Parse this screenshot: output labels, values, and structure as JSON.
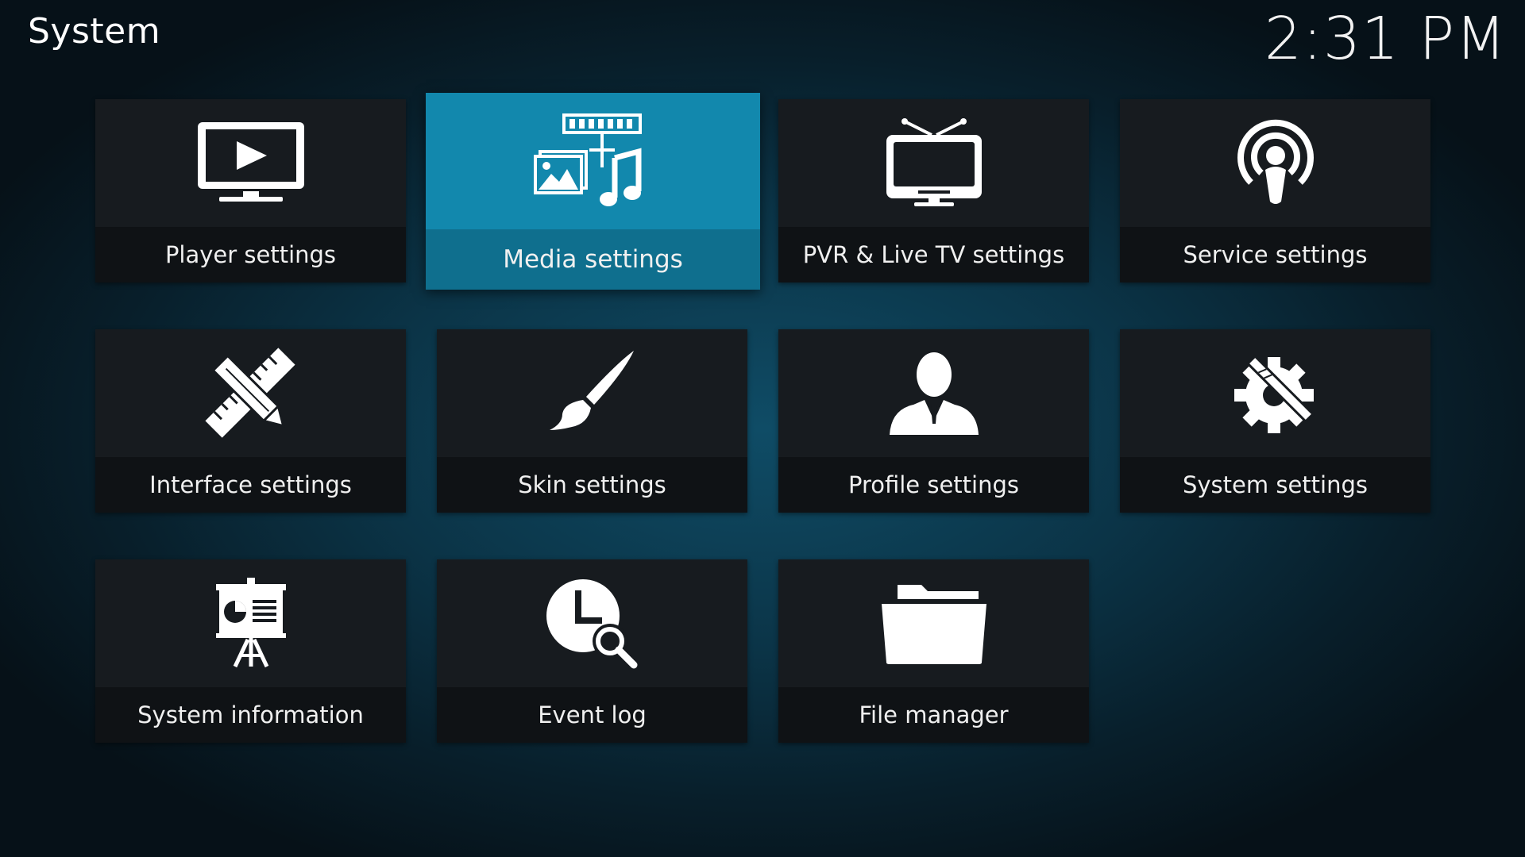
{
  "header": {
    "title": "System",
    "clock": "2:31 PM"
  },
  "tiles": [
    {
      "label": "Player settings",
      "icon": "tv-play-icon",
      "focused": false
    },
    {
      "label": "Media settings",
      "icon": "media-icon",
      "focused": true
    },
    {
      "label": "PVR & Live TV settings",
      "icon": "tv-antenna-icon",
      "focused": false
    },
    {
      "label": "Service settings",
      "icon": "broadcast-icon",
      "focused": false
    },
    {
      "label": "Interface settings",
      "icon": "pencil-ruler-icon",
      "focused": false
    },
    {
      "label": "Skin settings",
      "icon": "paintbrush-icon",
      "focused": false
    },
    {
      "label": "Profile settings",
      "icon": "user-icon",
      "focused": false
    },
    {
      "label": "System settings",
      "icon": "gear-tools-icon",
      "focused": false
    },
    {
      "label": "System information",
      "icon": "presentation-icon",
      "focused": false
    },
    {
      "label": "Event log",
      "icon": "clock-search-icon",
      "focused": false
    },
    {
      "label": "File manager",
      "icon": "folder-icon",
      "focused": false
    }
  ],
  "colors": {
    "accent": "#1289ae",
    "tile_bg": "#171b1f",
    "label_bg": "#0f1215"
  }
}
